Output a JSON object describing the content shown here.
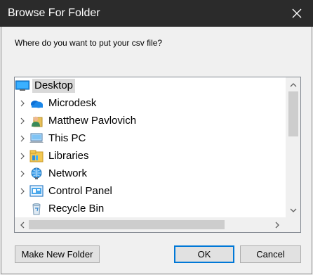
{
  "window": {
    "title": "Browse For Folder",
    "close_icon": "close-icon"
  },
  "prompt": "Where do you want to put your csv file?",
  "tree": {
    "items": [
      {
        "label": "Desktop",
        "icon": "desktop-icon",
        "expandable": false,
        "selected": true
      },
      {
        "label": "Microdesk",
        "icon": "onedrive-cloud-icon",
        "expandable": true,
        "selected": false
      },
      {
        "label": "Matthew Pavlovich",
        "icon": "user-folder-icon",
        "expandable": true,
        "selected": false
      },
      {
        "label": "This PC",
        "icon": "computer-icon",
        "expandable": true,
        "selected": false
      },
      {
        "label": "Libraries",
        "icon": "libraries-icon",
        "expandable": true,
        "selected": false
      },
      {
        "label": "Network",
        "icon": "network-icon",
        "expandable": true,
        "selected": false
      },
      {
        "label": "Control Panel",
        "icon": "control-panel-icon",
        "expandable": true,
        "selected": false
      },
      {
        "label": "Recycle Bin",
        "icon": "recycle-bin-icon",
        "expandable": false,
        "selected": false
      }
    ]
  },
  "buttons": {
    "new_folder": "Make New Folder",
    "ok": "OK",
    "cancel": "Cancel"
  },
  "colors": {
    "titlebar": "#2b2b2b",
    "accent": "#0078d7",
    "selection": "#d9d9d9"
  }
}
